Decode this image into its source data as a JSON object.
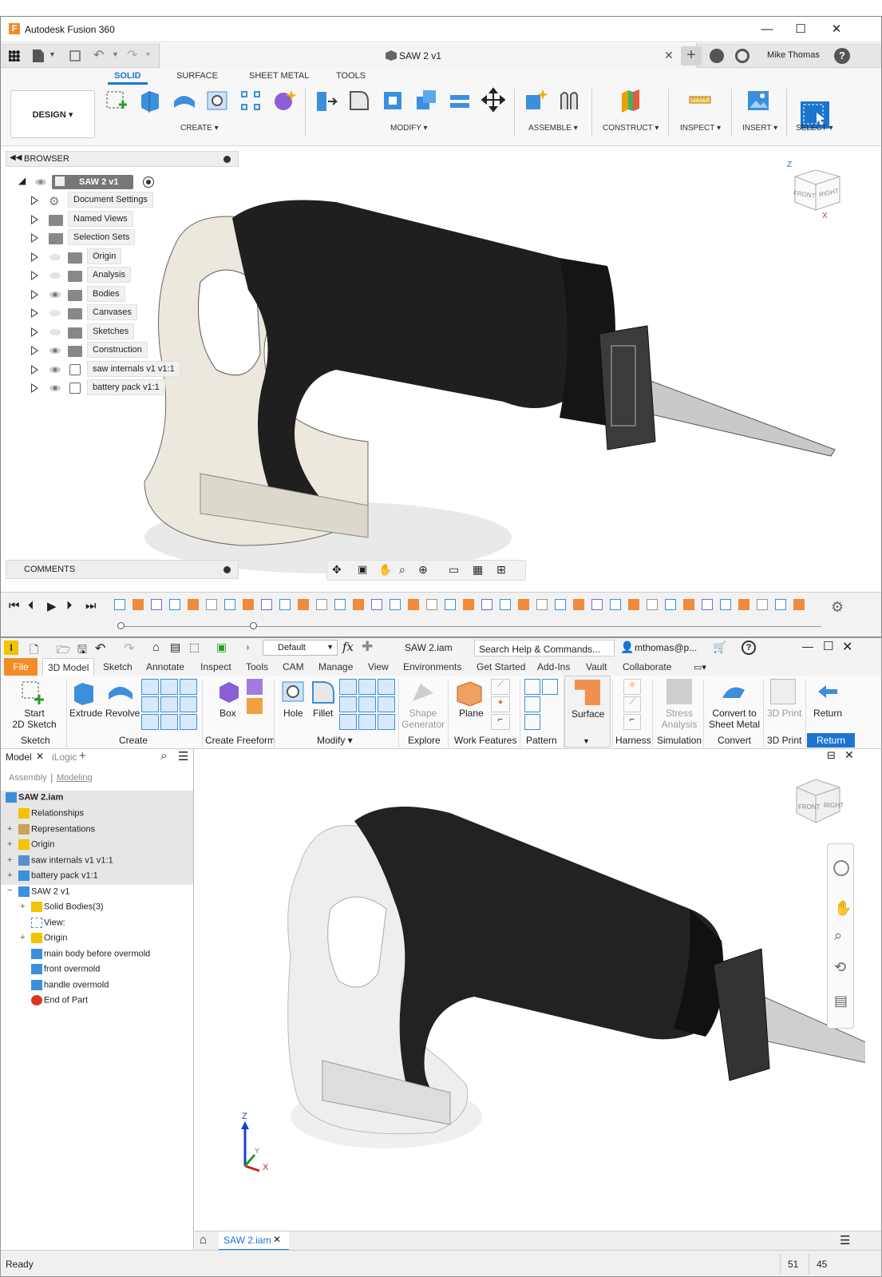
{
  "fusion": {
    "app_title": "Autodesk Fusion 360",
    "doc_tab": "SAW 2 v1",
    "user": "Mike Thomas",
    "ribbon_tabs": [
      "SOLID",
      "SURFACE",
      "SHEET METAL",
      "TOOLS"
    ],
    "design_btn": "DESIGN",
    "groups": {
      "create": "CREATE",
      "modify": "MODIFY",
      "assemble": "ASSEMBLE",
      "construct": "CONSTRUCT",
      "inspect": "INSPECT",
      "insert": "INSERT",
      "select": "SELECT"
    },
    "browser": {
      "title": "BROWSER",
      "root": "SAW 2 v1",
      "items": [
        {
          "label": "Document Settings"
        },
        {
          "label": "Named Views"
        },
        {
          "label": "Selection Sets"
        },
        {
          "label": "Origin"
        },
        {
          "label": "Analysis"
        },
        {
          "label": "Bodies"
        },
        {
          "label": "Canvases"
        },
        {
          "label": "Sketches"
        },
        {
          "label": "Construction"
        },
        {
          "label": "saw internals v1 v1:1"
        },
        {
          "label": "battery pack v1:1"
        }
      ]
    },
    "comments": "COMMENTS",
    "viewcube": {
      "front": "FRONT",
      "right": "RIGHT",
      "z": "Z",
      "x": "X"
    }
  },
  "inventor": {
    "doc_title": "SAW 2.iam",
    "appearance": "Default",
    "search_placeholder": "Search Help & Commands...",
    "user": "mthomas@p...",
    "tabs": [
      "File",
      "3D Model",
      "Sketch",
      "Annotate",
      "Inspect",
      "Tools",
      "CAM",
      "Manage",
      "View",
      "Environments",
      "Get Started",
      "Add-Ins",
      "Vault",
      "Collaborate"
    ],
    "ribbon": {
      "start_sketch": "Start",
      "start_sketch2": "2D Sketch",
      "extrude": "Extrude",
      "revolve": "Revolve",
      "box": "Box",
      "hole": "Hole",
      "fillet": "Fillet",
      "shape_gen": "Shape",
      "shape_gen2": "Generator",
      "plane": "Plane",
      "surface": "Surface",
      "stress": "Stress",
      "stress2": "Analysis",
      "convert_sm": "Convert to",
      "convert_sm2": "Sheet Metal",
      "print3d": "3D Print",
      "return": "Return",
      "groups": [
        "Sketch",
        "Create",
        "Create Freeform",
        "Modify",
        "Explore",
        "Work Features",
        "Pattern",
        "Harness",
        "Simulation",
        "Convert",
        "3D Print",
        "Return"
      ]
    },
    "browser": {
      "tab_model": "Model",
      "tab_ilogic": "iLogic",
      "sub_assembly": "Assembly",
      "sub_modeling": "Modeling",
      "tree": [
        {
          "label": "SAW 2.iam"
        },
        {
          "label": "Relationships"
        },
        {
          "label": "Representations"
        },
        {
          "label": "Origin"
        },
        {
          "label": "saw internals v1 v1:1"
        },
        {
          "label": "battery pack v1:1"
        },
        {
          "label": "SAW 2 v1"
        },
        {
          "label": "Solid Bodies(3)"
        },
        {
          "label": "View:"
        },
        {
          "label": "Origin"
        },
        {
          "label": "main body before overmold"
        },
        {
          "label": "front overmold"
        },
        {
          "label": "handle overmold"
        },
        {
          "label": "End of Part"
        }
      ]
    },
    "doc_tab": "SAW 2.iam",
    "status": {
      "ready": "Ready",
      "n1": "51",
      "n2": "45"
    },
    "axis": {
      "z": "Z",
      "x": "X",
      "y": "Y"
    },
    "viewcube": {
      "front": "FRONT",
      "right": "RIGHT"
    }
  }
}
